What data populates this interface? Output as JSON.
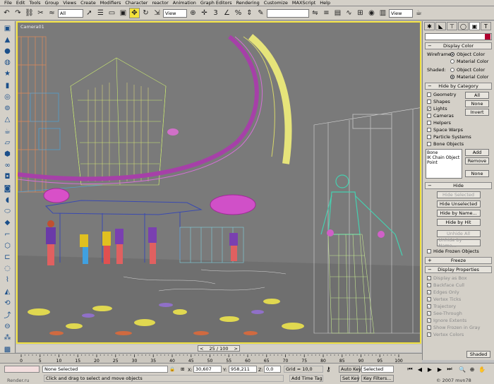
{
  "menu": [
    "File",
    "Edit",
    "Tools",
    "Group",
    "Views",
    "Create",
    "Modifiers",
    "Character",
    "reactor",
    "Animation",
    "Graph Editors",
    "Rendering",
    "Customize",
    "MAXScript",
    "Help"
  ],
  "toolbar": {
    "selection_filter": "All",
    "ref_coord": "View",
    "named_selection": "",
    "view_dropdown": "View"
  },
  "viewport": {
    "label": "Camera01"
  },
  "panel": {
    "rollouts": {
      "display_color": "Display Color",
      "hide_by_category": "Hide by Category",
      "hide": "Hide",
      "freeze": "Freeze",
      "display_properties": "Display Properties"
    },
    "display_color": {
      "wireframe_label": "Wireframe:",
      "shaded_label": "Shaded:",
      "object_color": "Object Color",
      "material_color": "Material Color"
    },
    "categories": [
      "Geometry",
      "Shapes",
      "Lights",
      "Cameras",
      "Helpers",
      "Space Warps",
      "Particle Systems",
      "Bone Objects"
    ],
    "category_buttons": {
      "all": "All",
      "none": "None",
      "invert": "Invert"
    },
    "list_items": [
      "Bone",
      "IK Chain Object",
      "Point"
    ],
    "list_buttons": {
      "add": "Add",
      "remove": "Remove",
      "none": "None"
    },
    "hide_buttons": [
      "Hide Selected",
      "Hide Unselected",
      "Hide by Name...",
      "Hide by Hit",
      "Unhide All",
      "Unhide by Name..."
    ],
    "hide_frozen": "Hide Frozen Objects",
    "display_props": [
      "Display as Box",
      "Backface Cull",
      "Edges Only",
      "Vertex Ticks",
      "Trajectory",
      "See-Through",
      "Ignore Extents",
      "Show Frozen in Gray",
      "Vertex Colors"
    ],
    "shaded_btn": "Shaded"
  },
  "timeline": {
    "frame_label": "25 / 100",
    "ticks": [
      "0",
      "5",
      "10",
      "15",
      "20",
      "25",
      "30",
      "35",
      "40",
      "45",
      "50",
      "55",
      "60",
      "65",
      "70",
      "75",
      "80",
      "85",
      "90",
      "95",
      "100"
    ]
  },
  "status": {
    "selection": "None Selected",
    "prompt": "Click and drag to select and move objects",
    "x_label": "X:",
    "x_val": "30,607",
    "y_label": "Y:",
    "y_val": "958,211",
    "z_label": "Z:",
    "z_val": "0,0",
    "grid": "Grid = 10,0",
    "add_time_tag": "Add Time Tag",
    "auto_key": "Auto Key",
    "set_key": "Set Key",
    "key_mode": "Selected",
    "key_filters": "Key Filters...",
    "watermark_left": "Render.ru",
    "watermark_right": "© 2007 mvn78"
  }
}
